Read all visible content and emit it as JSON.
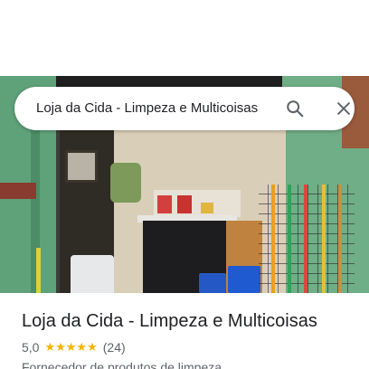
{
  "search": {
    "query": "Loja da Cida - Limpeza e Multicoisas",
    "search_icon": "search-icon",
    "close_icon": "close-icon"
  },
  "place": {
    "name": "Loja da Cida - Limpeza e Multicoisas",
    "rating": "5,0",
    "stars": "★★★★★",
    "star_count": 5,
    "reviews": "(24)",
    "category": "Fornecedor de produtos de limpeza"
  },
  "colors": {
    "star": "#f4b400",
    "text_primary": "#202124",
    "text_secondary": "#5f6368"
  }
}
